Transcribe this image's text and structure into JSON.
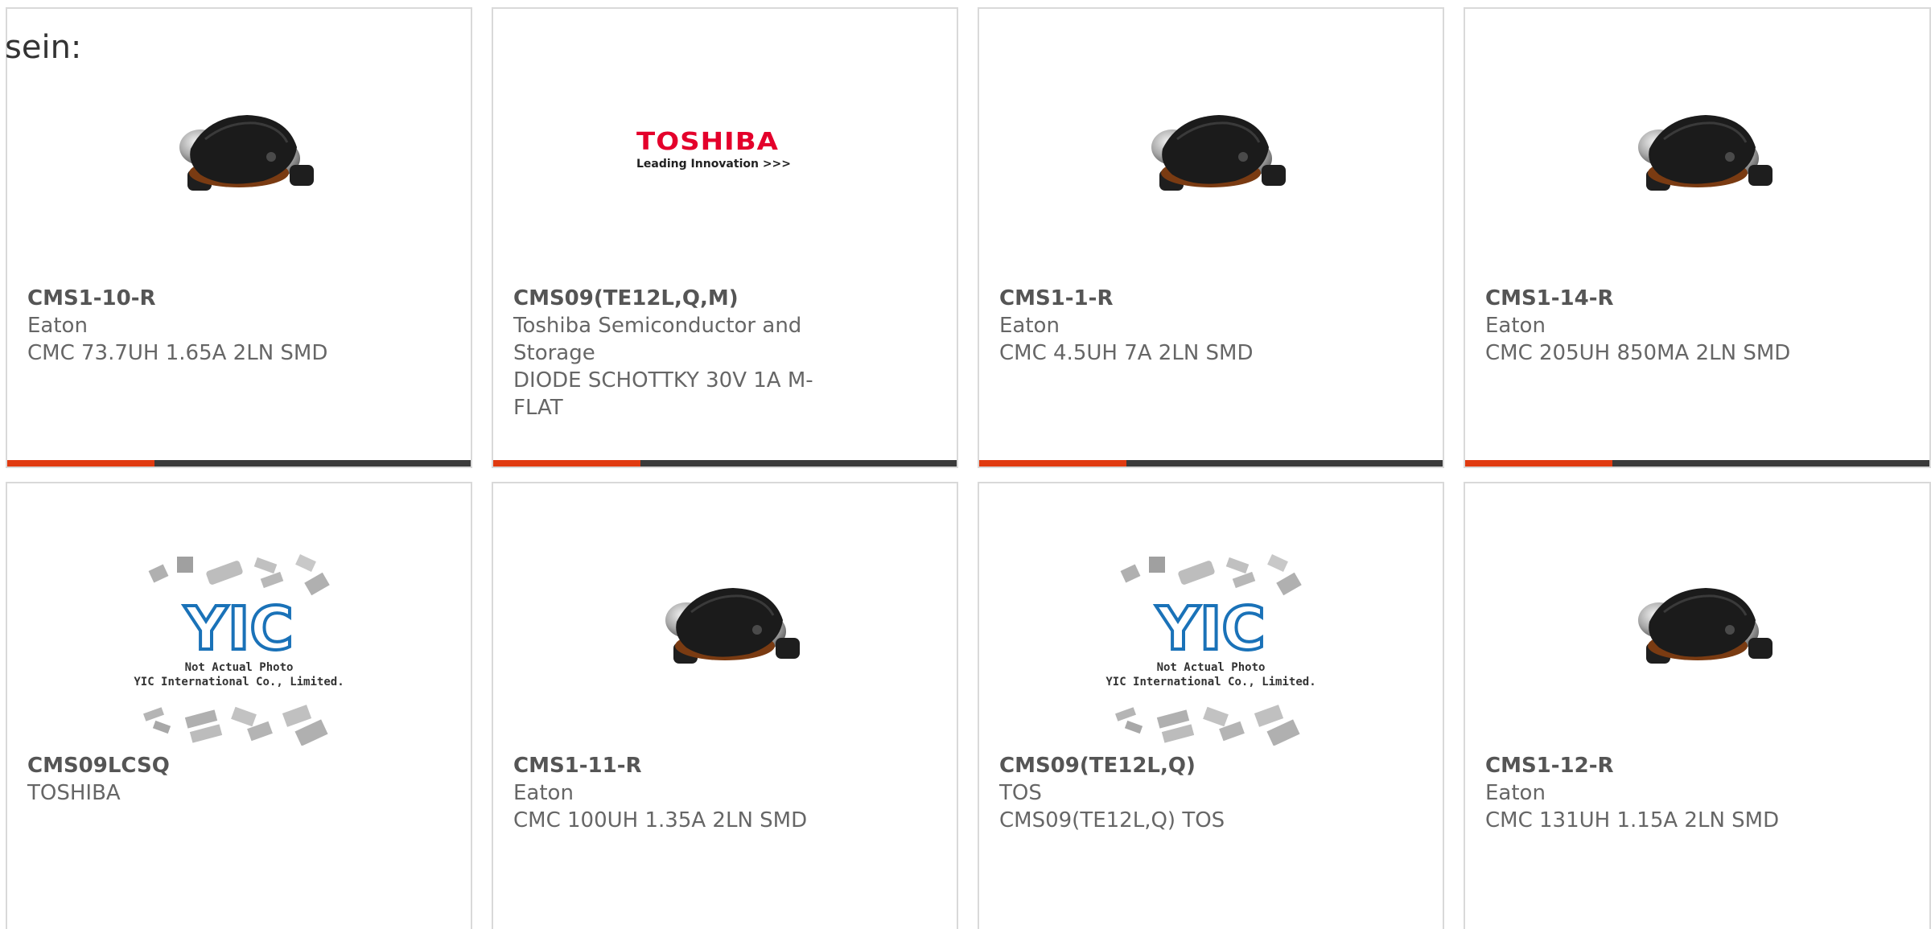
{
  "heading": "sein:",
  "colors": {
    "accent": "#e03a10",
    "bar": "#3a3a3a",
    "toshiba_red": "#e4002b",
    "yic_blue": "#1a72b8"
  },
  "products": [
    {
      "part": "CMS1-10-R",
      "manufacturer": "Eaton",
      "description": "CMC 73.7UH 1.65A 2LN SMD",
      "image": "inductor-photo"
    },
    {
      "part": "CMS09(TE12L,Q,M)",
      "manufacturer": "Toshiba Semiconductor and Storage",
      "description": "DIODE SCHOTTKY 30V 1A M-FLAT",
      "image": "toshiba-logo"
    },
    {
      "part": "CMS1-1-R",
      "manufacturer": "Eaton",
      "description": "CMC 4.5UH 7A 2LN SMD",
      "image": "inductor-photo"
    },
    {
      "part": "CMS1-14-R",
      "manufacturer": "Eaton",
      "description": "CMC 205UH 850MA 2LN SMD",
      "image": "inductor-photo"
    },
    {
      "part": "CMS09LCSQ",
      "manufacturer": "TOSHIBA",
      "description": "",
      "image": "yic-placeholder"
    },
    {
      "part": "CMS1-11-R",
      "manufacturer": "Eaton",
      "description": "CMC 100UH 1.35A 2LN SMD",
      "image": "inductor-photo"
    },
    {
      "part": "CMS09(TE12L,Q)",
      "manufacturer": "TOS",
      "description": "CMS09(TE12L,Q) TOS",
      "image": "yic-placeholder"
    },
    {
      "part": "CMS1-12-R",
      "manufacturer": "Eaton",
      "description": "CMC 131UH 1.15A 2LN SMD",
      "image": "inductor-photo"
    }
  ],
  "toshiba_logo": {
    "word": "TOSHIBA",
    "tagline": "Leading Innovation >>>"
  },
  "yic_placeholder": {
    "brand": "YIC",
    "line1": "Not Actual Photo",
    "line2": "YIC International Co., Limited."
  }
}
